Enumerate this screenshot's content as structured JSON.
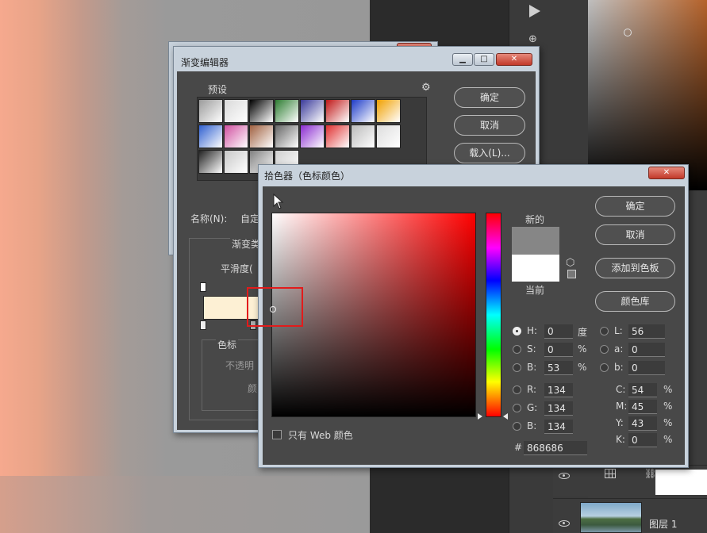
{
  "gradient_editor": {
    "title": "渐变编辑器",
    "presets_label": "预设",
    "ok": "确定",
    "cancel": "取消",
    "load": "载入(L)...",
    "name_label": "名称(N):",
    "name_value": "自定",
    "gradient_type_label": "渐变类",
    "smoothness_label": "平滑度(",
    "color_stops_label": "色标",
    "opacity_label": "不透明",
    "color_label": "颜",
    "swatches": [
      [
        "#9b9b9b",
        "#d9d9d9",
        "#000000",
        "#2e7d32",
        "#3a3a9a",
        "#c01818",
        "#1e3cc8",
        "#f0a000"
      ],
      [
        "#3060d0",
        "#d050a0",
        "#a06040",
        "#666666",
        "#8a2bd0",
        "#e03030",
        "#bbbbbb",
        "#dddddd"
      ],
      [
        "#222222",
        "#c8c8c8",
        "#808080",
        "#d0d0d0"
      ]
    ]
  },
  "color_picker": {
    "title": "拾色器（色标颜色）",
    "new_label": "新的",
    "current_label": "当前",
    "ok": "确定",
    "cancel": "取消",
    "add_to_swatches": "添加到色板",
    "color_libraries": "颜色库",
    "web_only_label": "只有 Web 颜色",
    "new_color": "#868686",
    "current_color": "#ffffff",
    "hsb": [
      {
        "label": "H:",
        "value": "0",
        "unit": "度",
        "selected": true
      },
      {
        "label": "S:",
        "value": "0",
        "unit": "%",
        "selected": false
      },
      {
        "label": "B:",
        "value": "53",
        "unit": "%",
        "selected": false
      }
    ],
    "rgb": [
      {
        "label": "R:",
        "value": "134"
      },
      {
        "label": "G:",
        "value": "134"
      },
      {
        "label": "B:",
        "value": "134"
      }
    ],
    "lab": [
      {
        "label": "L:",
        "value": "56"
      },
      {
        "label": "a:",
        "value": "0"
      },
      {
        "label": "b:",
        "value": "0"
      }
    ],
    "cmyk": [
      {
        "label": "C:",
        "value": "54",
        "unit": "%"
      },
      {
        "label": "M:",
        "value": "45",
        "unit": "%"
      },
      {
        "label": "Y:",
        "value": "43",
        "unit": "%"
      },
      {
        "label": "K:",
        "value": "0",
        "unit": "%"
      }
    ],
    "hex_label": "#",
    "hex_value": "868686"
  },
  "layers": {
    "layer1_name": "图层 1"
  },
  "window_buttons": {
    "minimize": "▁",
    "maximize": "□",
    "close": "✕"
  }
}
